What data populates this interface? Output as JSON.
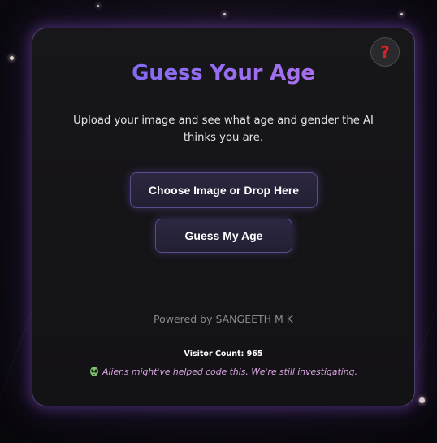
{
  "app": {
    "title": "Guess Your Age",
    "description": "Upload your image and see what age and gender the AI thinks you are."
  },
  "help": {
    "icon": "help-question-icon",
    "glyph": "?"
  },
  "buttons": {
    "choose_label": "Choose Image or Drop Here",
    "guess_label": "Guess My Age"
  },
  "footer": {
    "powered_by": "Powered by SANGEETH M K",
    "visitor_count": "Visitor Count: 965",
    "aliens_note": "Aliens might've helped code this. We're still investigating.",
    "aliens_icon": "alien-icon"
  },
  "colors": {
    "accent": "#8b6cf0",
    "help_mark": "#d8232a",
    "aliens_text": "#d9a6e2",
    "button_border": "#5a4c8e"
  }
}
